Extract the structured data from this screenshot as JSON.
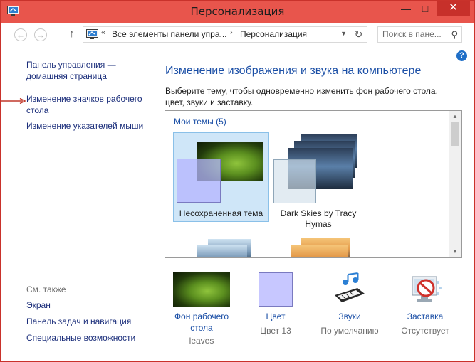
{
  "window": {
    "title": "Персонализация",
    "minimize_glyph": "—",
    "maximize_glyph": "□",
    "close_glyph": "✕"
  },
  "address": {
    "prefix": "«",
    "crumb1": "Все элементы панели упра...",
    "crumb2": "Персонализация",
    "separator": "›",
    "search_placeholder": "Поиск в пане..."
  },
  "left_pane": {
    "home_link": "Панель управления — домашняя страница",
    "links": [
      "Изменение значков рабочего стола",
      "Изменение указателей мыши"
    ],
    "see_also_title": "См. также",
    "see_also": [
      "Экран",
      "Панель задач и навигация",
      "Специальные возможности"
    ]
  },
  "main": {
    "heading": "Изменение изображения и звука на компьютере",
    "description": "Выберите тему, чтобы одновременно изменить фон рабочего стола, цвет, звуки и заставку.",
    "group_title": "Мои темы (5)",
    "themes": [
      {
        "name": "Несохраненная тема",
        "selected": true
      },
      {
        "name": "Dark Skies by Tracy Hymas",
        "selected": false
      }
    ]
  },
  "bottom": {
    "items": [
      {
        "label": "Фон рабочего стола",
        "value": "leaves"
      },
      {
        "label": "Цвет",
        "value": "Цвет 13"
      },
      {
        "label": "Звуки",
        "value": "По умолчанию"
      },
      {
        "label": "Заставка",
        "value": "Отсутствует"
      }
    ]
  },
  "colors": {
    "titlebar": "#e8554c",
    "link": "#1b4fa6",
    "selection": "#cfe6f8"
  },
  "icons": [
    "control-panel-icon",
    "back-arrow-icon",
    "forward-arrow-icon",
    "up-arrow-icon",
    "refresh-icon",
    "search-icon",
    "help-icon",
    "sounds-icon",
    "screensaver-icon"
  ]
}
